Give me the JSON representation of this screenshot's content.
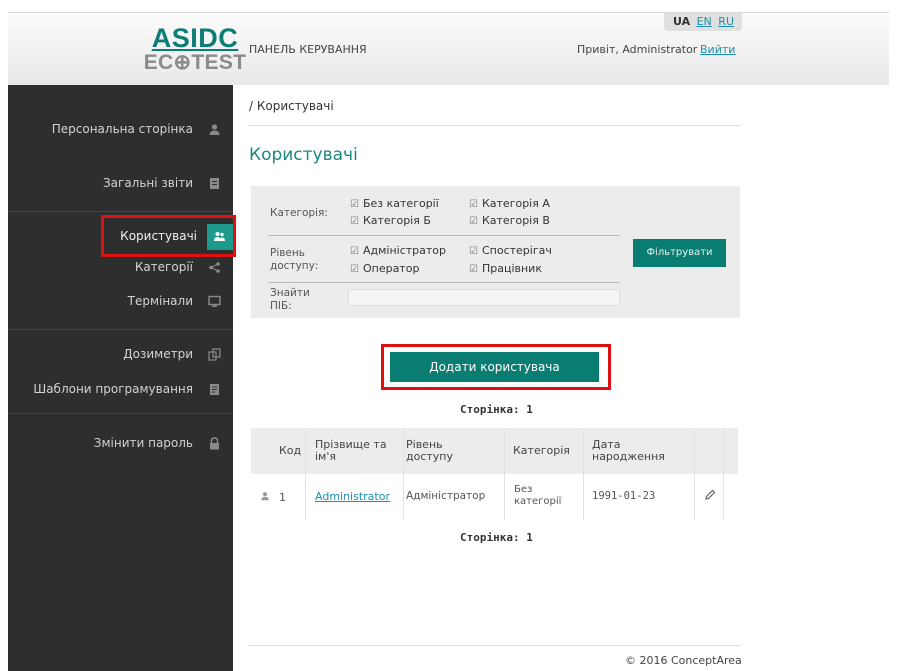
{
  "header": {
    "logo_top": "ASIDC",
    "logo_bottom": "EC⊕TEST",
    "panel_title": "ПАНЕЛЬ КЕРУВАННЯ",
    "languages": {
      "active": "UA",
      "others": [
        "EN",
        "RU"
      ]
    },
    "greeting": "Привіт, Administrator",
    "logout": "Вийти"
  },
  "sidebar": {
    "items": [
      {
        "label": "Персональна сторінка",
        "icon": "user-icon"
      },
      {
        "label": "Загальні звіти",
        "icon": "document-icon"
      },
      {
        "label": "Користувачі",
        "icon": "users-icon",
        "active": true
      },
      {
        "label": "Категорії",
        "icon": "share-icon"
      },
      {
        "label": "Термінали",
        "icon": "monitor-icon"
      },
      {
        "label": "Дозиметри",
        "icon": "copy-icon"
      },
      {
        "label": "Шаблони програмування",
        "icon": "template-icon"
      },
      {
        "label": "Змінити пароль",
        "icon": "lock-icon"
      }
    ]
  },
  "main": {
    "breadcrumb": "/ Користувачі",
    "title": "Користувачі",
    "filter": {
      "category_label": "Категорія:",
      "categories": [
        "Без категорії",
        "Категорія А",
        "Категорія Б",
        "Категорія В"
      ],
      "access_label": "Рівень доступу:",
      "access_levels": [
        "Адміністратор",
        "Спостерігач",
        "Оператор",
        "Працівник"
      ],
      "search_label": "Знайти ПІБ:",
      "search_value": "",
      "filter_button": "Фільтрувати"
    },
    "add_button": "Додати користувача",
    "page_label": "Сторінка: 1",
    "table": {
      "headers": [
        "Код",
        "Прізвище та ім'я",
        "Рівень доступу",
        "Категорія",
        "Дата народження"
      ],
      "rows": [
        {
          "code": "1",
          "name": "Administrator",
          "access": "Адміністратор",
          "category": "Без категорії",
          "birth": "1991-01-23"
        }
      ]
    }
  },
  "footer": {
    "copyright": "© 2016 ConceptArea"
  },
  "colors": {
    "accent": "#0a7d72",
    "sidebar": "#2e2e2e",
    "highlight": "#e01010",
    "link": "#1a8fb0"
  }
}
